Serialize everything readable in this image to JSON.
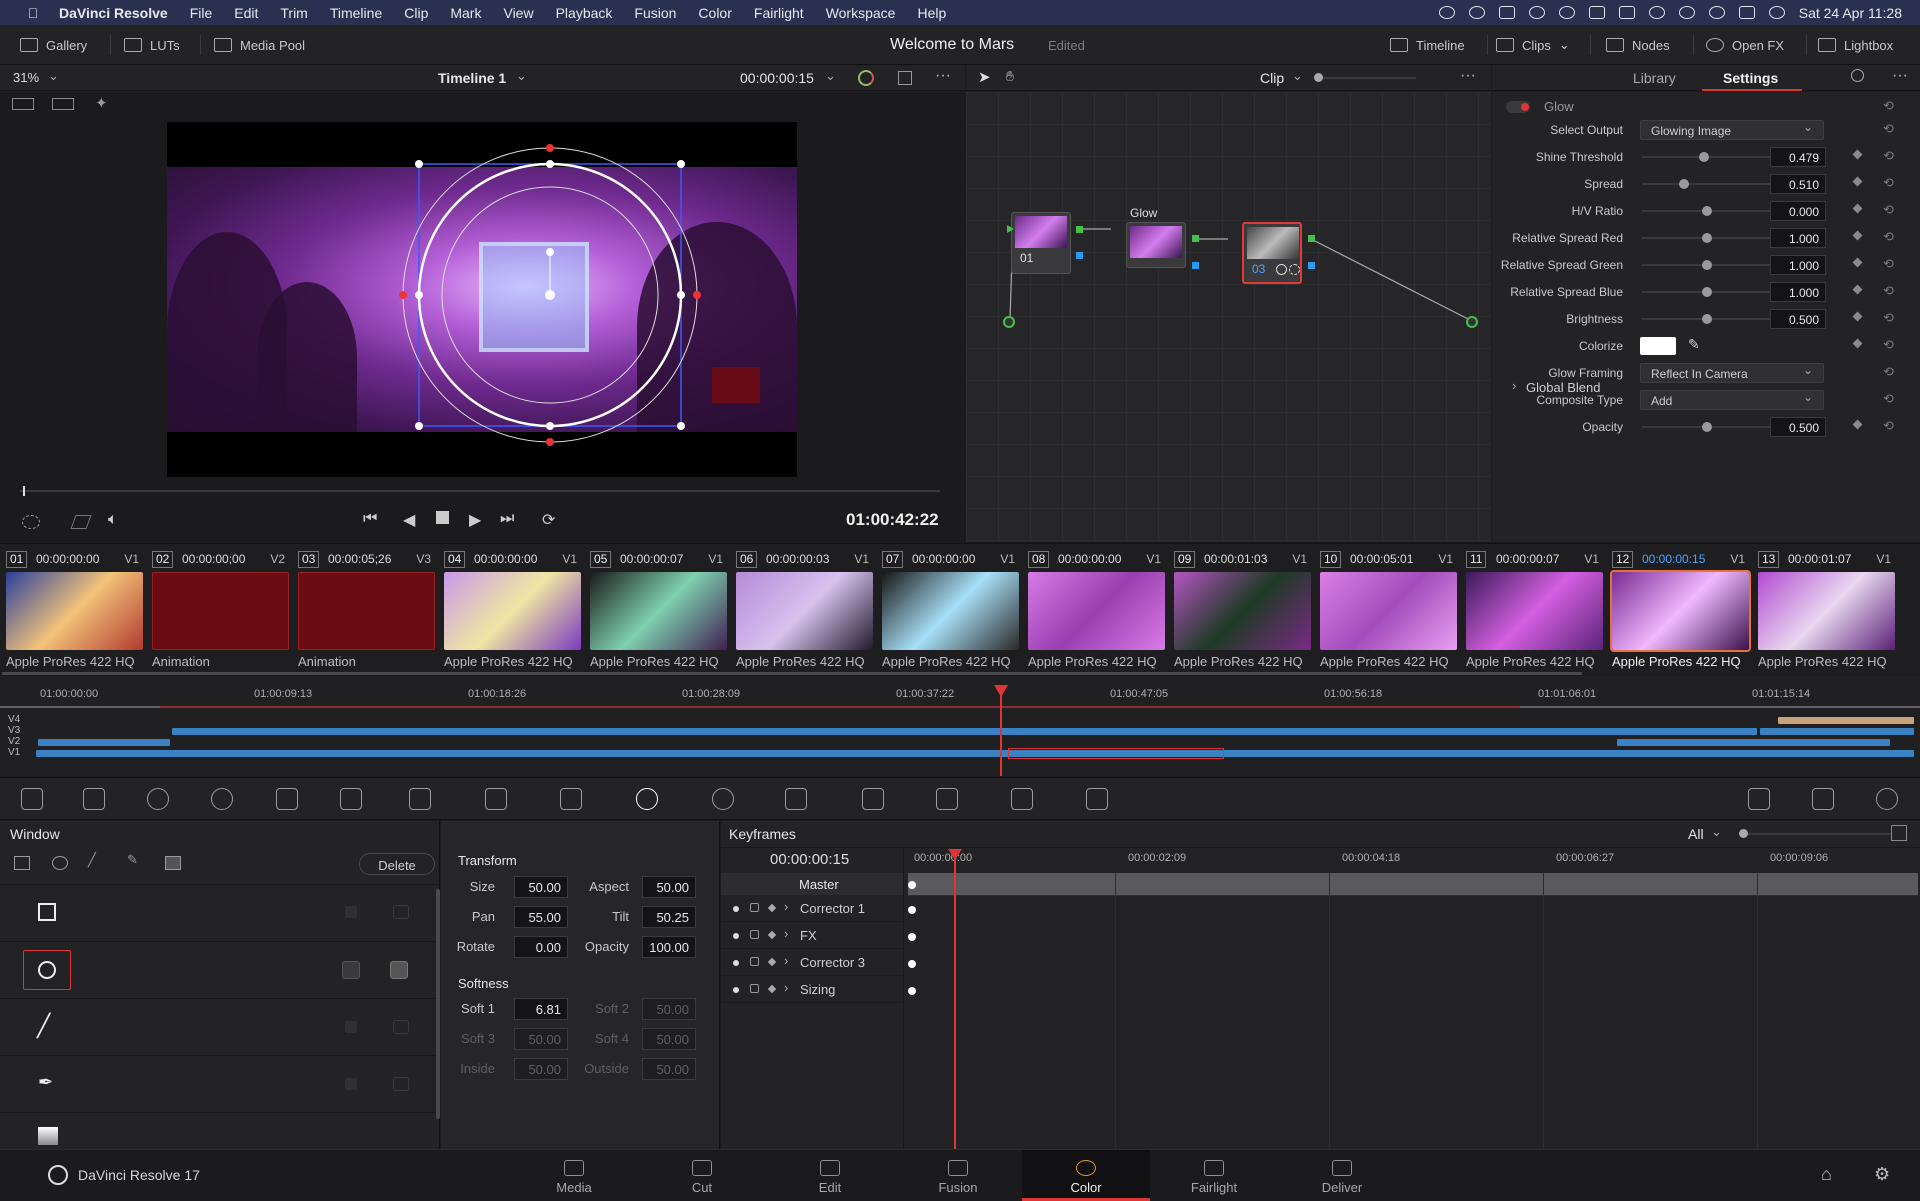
{
  "menubar": {
    "app": "DaVinci Resolve",
    "items": [
      "File",
      "Edit",
      "Trim",
      "Timeline",
      "Clip",
      "Mark",
      "View",
      "Playback",
      "Fusion",
      "Color",
      "Fairlight",
      "Workspace",
      "Help"
    ],
    "clock": "Sat 24 Apr  11:28"
  },
  "toolbar": {
    "gallery": "Gallery",
    "luts": "LUTs",
    "media_pool": "Media Pool",
    "project_title": "Welcome to Mars",
    "status": "Edited",
    "timeline": "Timeline",
    "clips": "Clips",
    "nodes": "Nodes",
    "open_fx": "Open FX",
    "lightbox": "Lightbox"
  },
  "viewer": {
    "zoom": "31%",
    "timeline_name": "Timeline 1",
    "timecode": "00:00:00:15",
    "playhead_tc": "01:00:42:22"
  },
  "node_editor": {
    "mode": "Clip",
    "nodes": [
      {
        "id": "01",
        "label": "01"
      },
      {
        "id": "02",
        "label": "Glow"
      },
      {
        "id": "03",
        "label": "03"
      }
    ]
  },
  "inspector": {
    "tabs": [
      "Library",
      "Settings"
    ],
    "active_tab": "Settings",
    "effect_name": "Glow",
    "params": [
      {
        "label": "Select Output",
        "type": "dropdown",
        "value": "Glowing Image"
      },
      {
        "label": "Shine Threshold",
        "type": "slider",
        "value": "0.479",
        "level": 0.479
      },
      {
        "label": "Spread",
        "type": "slider",
        "value": "0.510",
        "level": 0.31
      },
      {
        "label": "H/V Ratio",
        "type": "slider",
        "value": "0.000",
        "level": 0.5
      },
      {
        "label": "Relative Spread Red",
        "type": "slider",
        "value": "1.000",
        "level": 0.5
      },
      {
        "label": "Relative Spread Green",
        "type": "slider",
        "value": "1.000",
        "level": 0.5
      },
      {
        "label": "Relative Spread Blue",
        "type": "slider",
        "value": "1.000",
        "level": 0.5
      },
      {
        "label": "Brightness",
        "type": "slider",
        "value": "0.500",
        "level": 0.5
      },
      {
        "label": "Colorize",
        "type": "color",
        "value": "#ffffff"
      },
      {
        "label": "Glow Framing",
        "type": "dropdown",
        "value": "Reflect In Camera"
      },
      {
        "label": "Composite Type",
        "type": "dropdown",
        "value": "Add"
      },
      {
        "label": "Opacity",
        "type": "slider",
        "value": "0.500",
        "level": 0.5
      }
    ],
    "global_blend": "Global Blend"
  },
  "clips": [
    {
      "num": "01",
      "tc": "00:00:00:00",
      "track": "V1",
      "name": "Apple ProRes 422 HQ",
      "colors": [
        "#2a3f9a",
        "#f3c37a",
        "#b03a2e"
      ]
    },
    {
      "num": "02",
      "tc": "00:00:00;00",
      "track": "V2",
      "name": "Animation",
      "colors": [
        "#6a0c12",
        "#6a0c12",
        "#6a0c12"
      ]
    },
    {
      "num": "03",
      "tc": "00:00:05;26",
      "track": "V3",
      "name": "Animation",
      "colors": [
        "#6a0c12",
        "#6a0c12",
        "#6a0c12"
      ]
    },
    {
      "num": "04",
      "tc": "00:00:00:00",
      "track": "V1",
      "name": "Apple ProRes 422 HQ",
      "colors": [
        "#c89ae8",
        "#f0e6a2",
        "#7b3ac0"
      ]
    },
    {
      "num": "05",
      "tc": "00:00:00:07",
      "track": "V1",
      "name": "Apple ProRes 422 HQ",
      "colors": [
        "#1a1a1a",
        "#7fd0b0",
        "#402050"
      ]
    },
    {
      "num": "06",
      "tc": "00:00:00:03",
      "track": "V1",
      "name": "Apple ProRes 422 HQ",
      "colors": [
        "#b58ad8",
        "#d7c2ee",
        "#221a2c"
      ]
    },
    {
      "num": "07",
      "tc": "00:00:00:00",
      "track": "V1",
      "name": "Apple ProRes 422 HQ",
      "colors": [
        "#161616",
        "#a8e0f8",
        "#2a2a2a"
      ]
    },
    {
      "num": "08",
      "tc": "00:00:00:00",
      "track": "V1",
      "name": "Apple ProRes 422 HQ",
      "colors": [
        "#d67be6",
        "#9a3fb0",
        "#d67be6"
      ]
    },
    {
      "num": "09",
      "tc": "00:00:01:03",
      "track": "V1",
      "name": "Apple ProRes 422 HQ",
      "colors": [
        "#b455c2",
        "#1e3a24",
        "#7a2a86"
      ]
    },
    {
      "num": "10",
      "tc": "00:00:05:01",
      "track": "V1",
      "name": "Apple ProRes 422 HQ",
      "colors": [
        "#d880e6",
        "#a44cbc",
        "#e8a0f0"
      ]
    },
    {
      "num": "11",
      "tc": "00:00:00:07",
      "track": "V1",
      "name": "Apple ProRes 422 HQ",
      "colors": [
        "#3b1a5a",
        "#d45fe0",
        "#5a2478"
      ]
    },
    {
      "num": "12",
      "tc": "00:00:00:15",
      "track": "V1",
      "name": "Apple ProRes 422 HQ",
      "colors": [
        "#7a2a92",
        "#f0b8ff",
        "#3a124a"
      ]
    },
    {
      "num": "13",
      "tc": "00:00:01:07",
      "track": "V1",
      "name": "Apple ProRes 422 HQ",
      "colors": [
        "#b24ad0",
        "#e8d8f0",
        "#5a2076"
      ]
    }
  ],
  "timeline": {
    "ticks": [
      "01:00:00:00",
      "01:00:09:13",
      "01:00:18:26",
      "01:00:28:09",
      "01:00:37:22",
      "01:00:47:05",
      "01:00:56:18",
      "01:01:06:01",
      "01:01:15:14"
    ],
    "tracks": [
      "V4",
      "V3",
      "V2",
      "V1"
    ],
    "playhead_position": 0.5
  },
  "window_panel": {
    "title": "Window",
    "delete": "Delete",
    "shapes": [
      "square",
      "circle",
      "line",
      "pen",
      "gradient"
    ]
  },
  "transform": {
    "title": "Transform",
    "size_label": "Size",
    "size": "50.00",
    "aspect_label": "Aspect",
    "aspect": "50.00",
    "pan_label": "Pan",
    "pan": "55.00",
    "tilt_label": "Tilt",
    "tilt": "50.25",
    "rotate_label": "Rotate",
    "rotate": "0.00",
    "opacity_label": "Opacity",
    "opacity": "100.00",
    "softness_title": "Softness",
    "soft1_label": "Soft 1",
    "soft1": "6.81",
    "soft2_label": "Soft 2",
    "soft2": "50.00",
    "soft3_label": "Soft 3",
    "soft3": "50.00",
    "soft4_label": "Soft 4",
    "soft4": "50.00",
    "inside_label": "Inside",
    "inside": "50.00",
    "outside_label": "Outside",
    "outside": "50.00"
  },
  "keyframes": {
    "title": "Keyframes",
    "filter": "All",
    "timecode": "00:00:00:15",
    "ruler": [
      "00:00:00:00",
      "00:00:02:09",
      "00:00:04:18",
      "00:00:06:27",
      "00:00:09:06"
    ],
    "master": "Master",
    "rows": [
      "Corrector 1",
      "FX",
      "Corrector 3",
      "Sizing"
    ]
  },
  "bottomnav": {
    "app_name": "DaVinci Resolve 17",
    "pages": [
      "Media",
      "Cut",
      "Edit",
      "Fusion",
      "Color",
      "Fairlight",
      "Deliver"
    ],
    "active": "Color"
  }
}
